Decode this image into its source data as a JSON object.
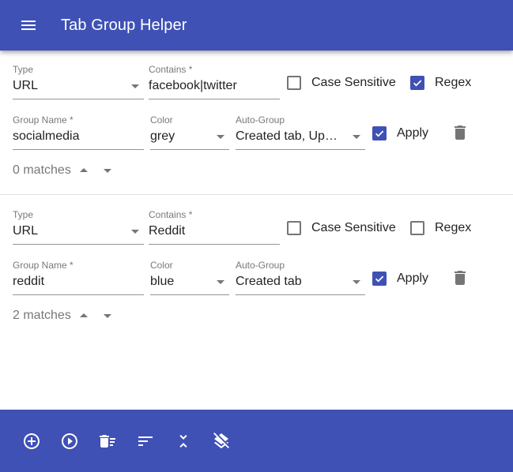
{
  "appbar": {
    "title": "Tab Group Helper",
    "menu_icon": "menu-icon"
  },
  "theme": {
    "primary": "#3f51b5",
    "on_primary": "#ffffff",
    "divider": "#e0e0e0"
  },
  "rules": [
    {
      "type_label": "Type",
      "type_value": "URL",
      "contains_label": "Contains *",
      "contains_value": "facebook|twitter",
      "case_sensitive_label": "Case Sensitive",
      "case_sensitive_checked": false,
      "regex_label": "Regex",
      "regex_checked": true,
      "group_name_label": "Group Name *",
      "group_name_value": "socialmedia",
      "color_label": "Color",
      "color_value": "grey",
      "auto_group_label": "Auto-Group",
      "auto_group_value": "Created tab, Up…",
      "apply_label": "Apply",
      "apply_checked": true,
      "delete_icon": "delete-icon",
      "matches_text": "0 matches"
    },
    {
      "type_label": "Type",
      "type_value": "URL",
      "contains_label": "Contains *",
      "contains_value": "Reddit",
      "case_sensitive_label": "Case Sensitive",
      "case_sensitive_checked": false,
      "regex_label": "Regex",
      "regex_checked": false,
      "group_name_label": "Group Name *",
      "group_name_value": "reddit",
      "color_label": "Color",
      "color_value": "blue",
      "auto_group_label": "Auto-Group",
      "auto_group_value": "Created tab",
      "apply_label": "Apply",
      "apply_checked": true,
      "delete_icon": "delete-icon",
      "matches_text": "2 matches"
    }
  ],
  "bottombar": {
    "buttons": [
      {
        "icon": "add-circle-icon",
        "action": "add rule"
      },
      {
        "icon": "play-circle-icon",
        "action": "apply all"
      },
      {
        "icon": "delete-sweep-icon",
        "action": "delete all"
      },
      {
        "icon": "sort-icon",
        "action": "sort"
      },
      {
        "icon": "collapse-all-icon",
        "action": "collapse"
      },
      {
        "icon": "layers-clear-icon",
        "action": "ungroup all"
      }
    ]
  }
}
